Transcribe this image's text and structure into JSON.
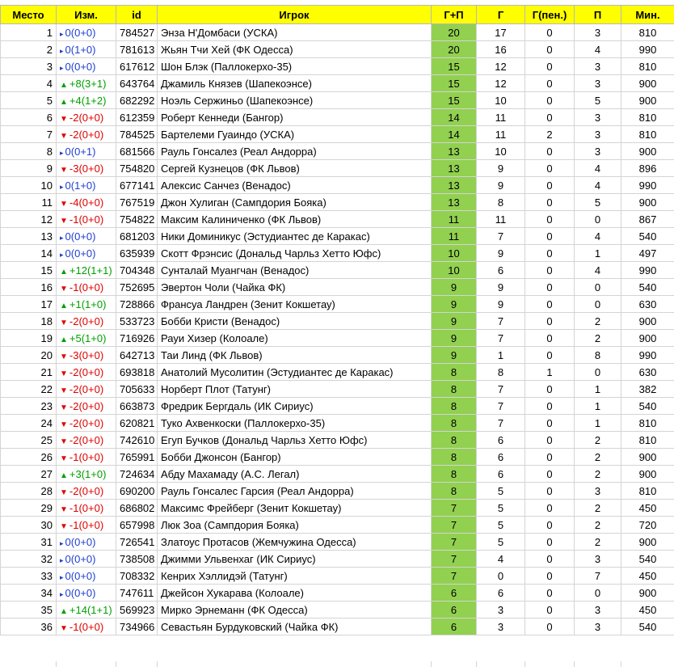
{
  "columns": {
    "rank": "Место",
    "change": "Изм.",
    "id": "id",
    "player": "Игрок",
    "gp": "Г+П",
    "goals": "Г",
    "pen": "Г(пен.)",
    "assists": "П",
    "minutes": "Мин."
  },
  "colors": {
    "header": "#ffff00",
    "gp_cell": "#92d050",
    "up": "#00a000",
    "down": "#e00000",
    "same": "#1f3fd0"
  },
  "rows": [
    {
      "rank": "1",
      "dir": "same",
      "change": "0(0+0)",
      "id": "784527",
      "player": "Энза Н'Домбаси (УСКА)",
      "gp": "20",
      "goals": "17",
      "pen": "0",
      "assists": "3",
      "minutes": "810"
    },
    {
      "rank": "2",
      "dir": "same",
      "change": "0(1+0)",
      "id": "781613",
      "player": "Жьян Тчи Хей (ФК Одесса)",
      "gp": "20",
      "goals": "16",
      "pen": "0",
      "assists": "4",
      "minutes": "990"
    },
    {
      "rank": "3",
      "dir": "same",
      "change": "0(0+0)",
      "id": "617612",
      "player": "Шон Блэк (Паллокерхо-35)",
      "gp": "15",
      "goals": "12",
      "pen": "0",
      "assists": "3",
      "minutes": "810"
    },
    {
      "rank": "4",
      "dir": "up",
      "change": "+8(3+1)",
      "id": "643764",
      "player": "Джамиль Князев (Шапекоэнсе)",
      "gp": "15",
      "goals": "12",
      "pen": "0",
      "assists": "3",
      "minutes": "900"
    },
    {
      "rank": "5",
      "dir": "up",
      "change": "+4(1+2)",
      "id": "682292",
      "player": "Ноэль Сержиньо (Шапекоэнсе)",
      "gp": "15",
      "goals": "10",
      "pen": "0",
      "assists": "5",
      "minutes": "900"
    },
    {
      "rank": "6",
      "dir": "down",
      "change": "-2(0+0)",
      "id": "612359",
      "player": "Роберт Кеннеди (Бангор)",
      "gp": "14",
      "goals": "11",
      "pen": "0",
      "assists": "3",
      "minutes": "810"
    },
    {
      "rank": "7",
      "dir": "down",
      "change": "-2(0+0)",
      "id": "784525",
      "player": "Бартелеми Гуаиндо (УСКА)",
      "gp": "14",
      "goals": "11",
      "pen": "2",
      "assists": "3",
      "minutes": "810"
    },
    {
      "rank": "8",
      "dir": "same",
      "change": "0(0+1)",
      "id": "681566",
      "player": "Рауль Гонсалез (Реал Андорра)",
      "gp": "13",
      "goals": "10",
      "pen": "0",
      "assists": "3",
      "minutes": "900"
    },
    {
      "rank": "9",
      "dir": "down",
      "change": "-3(0+0)",
      "id": "754820",
      "player": "Сергей Кузнецов (ФК Львов)",
      "gp": "13",
      "goals": "9",
      "pen": "0",
      "assists": "4",
      "minutes": "896"
    },
    {
      "rank": "10",
      "dir": "same",
      "change": "0(1+0)",
      "id": "677141",
      "player": "Алексис Санчез (Венадос)",
      "gp": "13",
      "goals": "9",
      "pen": "0",
      "assists": "4",
      "minutes": "990"
    },
    {
      "rank": "11",
      "dir": "down",
      "change": "-4(0+0)",
      "id": "767519",
      "player": "Джон Хулиган (Сампдория Бояка)",
      "gp": "13",
      "goals": "8",
      "pen": "0",
      "assists": "5",
      "minutes": "900"
    },
    {
      "rank": "12",
      "dir": "down",
      "change": "-1(0+0)",
      "id": "754822",
      "player": "Максим Калиниченко (ФК Львов)",
      "gp": "11",
      "goals": "11",
      "pen": "0",
      "assists": "0",
      "minutes": "867"
    },
    {
      "rank": "13",
      "dir": "same",
      "change": "0(0+0)",
      "id": "681203",
      "player": "Ники Доминикус (Эстудиантес де Каракас)",
      "gp": "11",
      "goals": "7",
      "pen": "0",
      "assists": "4",
      "minutes": "540"
    },
    {
      "rank": "14",
      "dir": "same",
      "change": "0(0+0)",
      "id": "635939",
      "player": "Скотт Фрэнсис (Дональд Чарльз Хетто Юфс)",
      "gp": "10",
      "goals": "9",
      "pen": "0",
      "assists": "1",
      "minutes": "497"
    },
    {
      "rank": "15",
      "dir": "up",
      "change": "+12(1+1)",
      "id": "704348",
      "player": "Сунталай Муангчан (Венадос)",
      "gp": "10",
      "goals": "6",
      "pen": "0",
      "assists": "4",
      "minutes": "990"
    },
    {
      "rank": "16",
      "dir": "down",
      "change": "-1(0+0)",
      "id": "752695",
      "player": "Эвертон Чоли (Чайка ФК)",
      "gp": "9",
      "goals": "9",
      "pen": "0",
      "assists": "0",
      "minutes": "540"
    },
    {
      "rank": "17",
      "dir": "up",
      "change": "+1(1+0)",
      "id": "728866",
      "player": "Франсуа Ландрен (Зенит Кокшетау)",
      "gp": "9",
      "goals": "9",
      "pen": "0",
      "assists": "0",
      "minutes": "630"
    },
    {
      "rank": "18",
      "dir": "down",
      "change": "-2(0+0)",
      "id": "533723",
      "player": "Бобби Кристи (Венадос)",
      "gp": "9",
      "goals": "7",
      "pen": "0",
      "assists": "2",
      "minutes": "900"
    },
    {
      "rank": "19",
      "dir": "up",
      "change": "+5(1+0)",
      "id": "716926",
      "player": "Рауи Хизер (Колоале)",
      "gp": "9",
      "goals": "7",
      "pen": "0",
      "assists": "2",
      "minutes": "900"
    },
    {
      "rank": "20",
      "dir": "down",
      "change": "-3(0+0)",
      "id": "642713",
      "player": "Таи Линд (ФК Львов)",
      "gp": "9",
      "goals": "1",
      "pen": "0",
      "assists": "8",
      "minutes": "990"
    },
    {
      "rank": "21",
      "dir": "down",
      "change": "-2(0+0)",
      "id": "693818",
      "player": "Анатолий Мусолитин (Эстудиантес де Каракас)",
      "gp": "8",
      "goals": "8",
      "pen": "1",
      "assists": "0",
      "minutes": "630"
    },
    {
      "rank": "22",
      "dir": "down",
      "change": "-2(0+0)",
      "id": "705633",
      "player": "Норберт Плот (Татунг)",
      "gp": "8",
      "goals": "7",
      "pen": "0",
      "assists": "1",
      "minutes": "382"
    },
    {
      "rank": "23",
      "dir": "down",
      "change": "-2(0+0)",
      "id": "663873",
      "player": "Фредрик Бергдаль (ИК Сириус)",
      "gp": "8",
      "goals": "7",
      "pen": "0",
      "assists": "1",
      "minutes": "540"
    },
    {
      "rank": "24",
      "dir": "down",
      "change": "-2(0+0)",
      "id": "620821",
      "player": "Туко Ахвенкоски (Паллокерхо-35)",
      "gp": "8",
      "goals": "7",
      "pen": "0",
      "assists": "1",
      "minutes": "810"
    },
    {
      "rank": "25",
      "dir": "down",
      "change": "-2(0+0)",
      "id": "742610",
      "player": "Егуп Бучков (Дональд Чарльз Хетто Юфс)",
      "gp": "8",
      "goals": "6",
      "pen": "0",
      "assists": "2",
      "minutes": "810"
    },
    {
      "rank": "26",
      "dir": "down",
      "change": "-1(0+0)",
      "id": "765991",
      "player": "Бобби Джонсон (Бангор)",
      "gp": "8",
      "goals": "6",
      "pen": "0",
      "assists": "2",
      "minutes": "900"
    },
    {
      "rank": "27",
      "dir": "up",
      "change": "+3(1+0)",
      "id": "724634",
      "player": "Абду Махамаду (А.С. Легал)",
      "gp": "8",
      "goals": "6",
      "pen": "0",
      "assists": "2",
      "minutes": "900"
    },
    {
      "rank": "28",
      "dir": "down",
      "change": "-2(0+0)",
      "id": "690200",
      "player": "Рауль Гонсалес Гарсия (Реал Андорра)",
      "gp": "8",
      "goals": "5",
      "pen": "0",
      "assists": "3",
      "minutes": "810"
    },
    {
      "rank": "29",
      "dir": "down",
      "change": "-1(0+0)",
      "id": "686802",
      "player": "Максимс Фрейберг (Зенит Кокшетау)",
      "gp": "7",
      "goals": "5",
      "pen": "0",
      "assists": "2",
      "minutes": "450"
    },
    {
      "rank": "30",
      "dir": "down",
      "change": "-1(0+0)",
      "id": "657998",
      "player": "Люк Зоа (Сампдория Бояка)",
      "gp": "7",
      "goals": "5",
      "pen": "0",
      "assists": "2",
      "minutes": "720"
    },
    {
      "rank": "31",
      "dir": "same",
      "change": "0(0+0)",
      "id": "726541",
      "player": "Златоус Протасов (Жемчужина Одесса)",
      "gp": "7",
      "goals": "5",
      "pen": "0",
      "assists": "2",
      "minutes": "900"
    },
    {
      "rank": "32",
      "dir": "same",
      "change": "0(0+0)",
      "id": "738508",
      "player": "Джимми Ульвенхаг (ИК Сириус)",
      "gp": "7",
      "goals": "4",
      "pen": "0",
      "assists": "3",
      "minutes": "540"
    },
    {
      "rank": "33",
      "dir": "same",
      "change": "0(0+0)",
      "id": "708332",
      "player": "Кенрих Хэллидэй (Татунг)",
      "gp": "7",
      "goals": "0",
      "pen": "0",
      "assists": "7",
      "minutes": "450"
    },
    {
      "rank": "34",
      "dir": "same",
      "change": "0(0+0)",
      "id": "747611",
      "player": "Джейсон Хукарава (Колоале)",
      "gp": "6",
      "goals": "6",
      "pen": "0",
      "assists": "0",
      "minutes": "900"
    },
    {
      "rank": "35",
      "dir": "up",
      "change": "+14(1+1)",
      "id": "569923",
      "player": "Мирко Эрнеманн (ФК Одесса)",
      "gp": "6",
      "goals": "3",
      "pen": "0",
      "assists": "3",
      "minutes": "450"
    },
    {
      "rank": "36",
      "dir": "down",
      "change": "-1(0+0)",
      "id": "734966",
      "player": "Севастьян Бурдуковский (Чайка ФК)",
      "gp": "6",
      "goals": "3",
      "pen": "0",
      "assists": "3",
      "minutes": "540"
    }
  ]
}
